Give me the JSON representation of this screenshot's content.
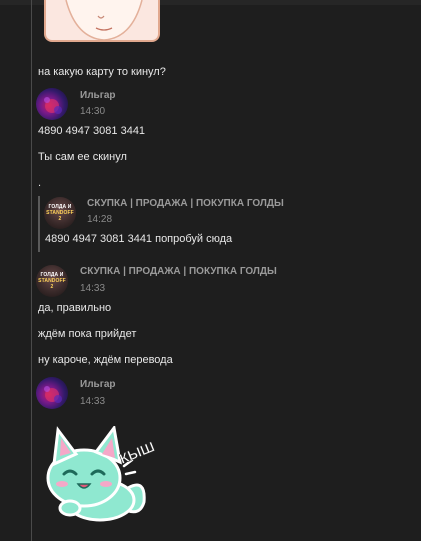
{
  "messages": {
    "m1_text": "на какую карту то кинул?",
    "ilgar_1": {
      "author": "Ильгар",
      "time": "14:30"
    },
    "m2_text": "4890 4947 3081 3441",
    "m3_text": "Ты сам ее скинул",
    "m4_text": ".",
    "quote": {
      "author": "СКУПКА | ПРОДАЖА | ПОКУПКА ГОЛДЫ",
      "time": "14:28",
      "text": "4890 4947 3081 3441 попробуй сюда"
    },
    "shop_1": {
      "author": "СКУПКА | ПРОДАЖА | ПОКУПКА ГОЛДЫ",
      "time": "14:33"
    },
    "m5_text": "да, правильно",
    "m6_text": "ждём пока прийдет",
    "m7_text": "ну кароче, ждём перевода",
    "ilgar_2": {
      "author": "Ильгар",
      "time": "14:33"
    }
  },
  "avatar_logo": {
    "line1": "ГОЛДА И",
    "line2": "STANDOFF 2"
  },
  "sticker_text": "КЫШ",
  "colors": {
    "background": "#1e1e1e",
    "text": "#e8e8e8",
    "author": "#9a9a9a",
    "time": "#8a8a8a",
    "cat_body": "#8fe8d0",
    "cat_outline": "#ffffff"
  }
}
